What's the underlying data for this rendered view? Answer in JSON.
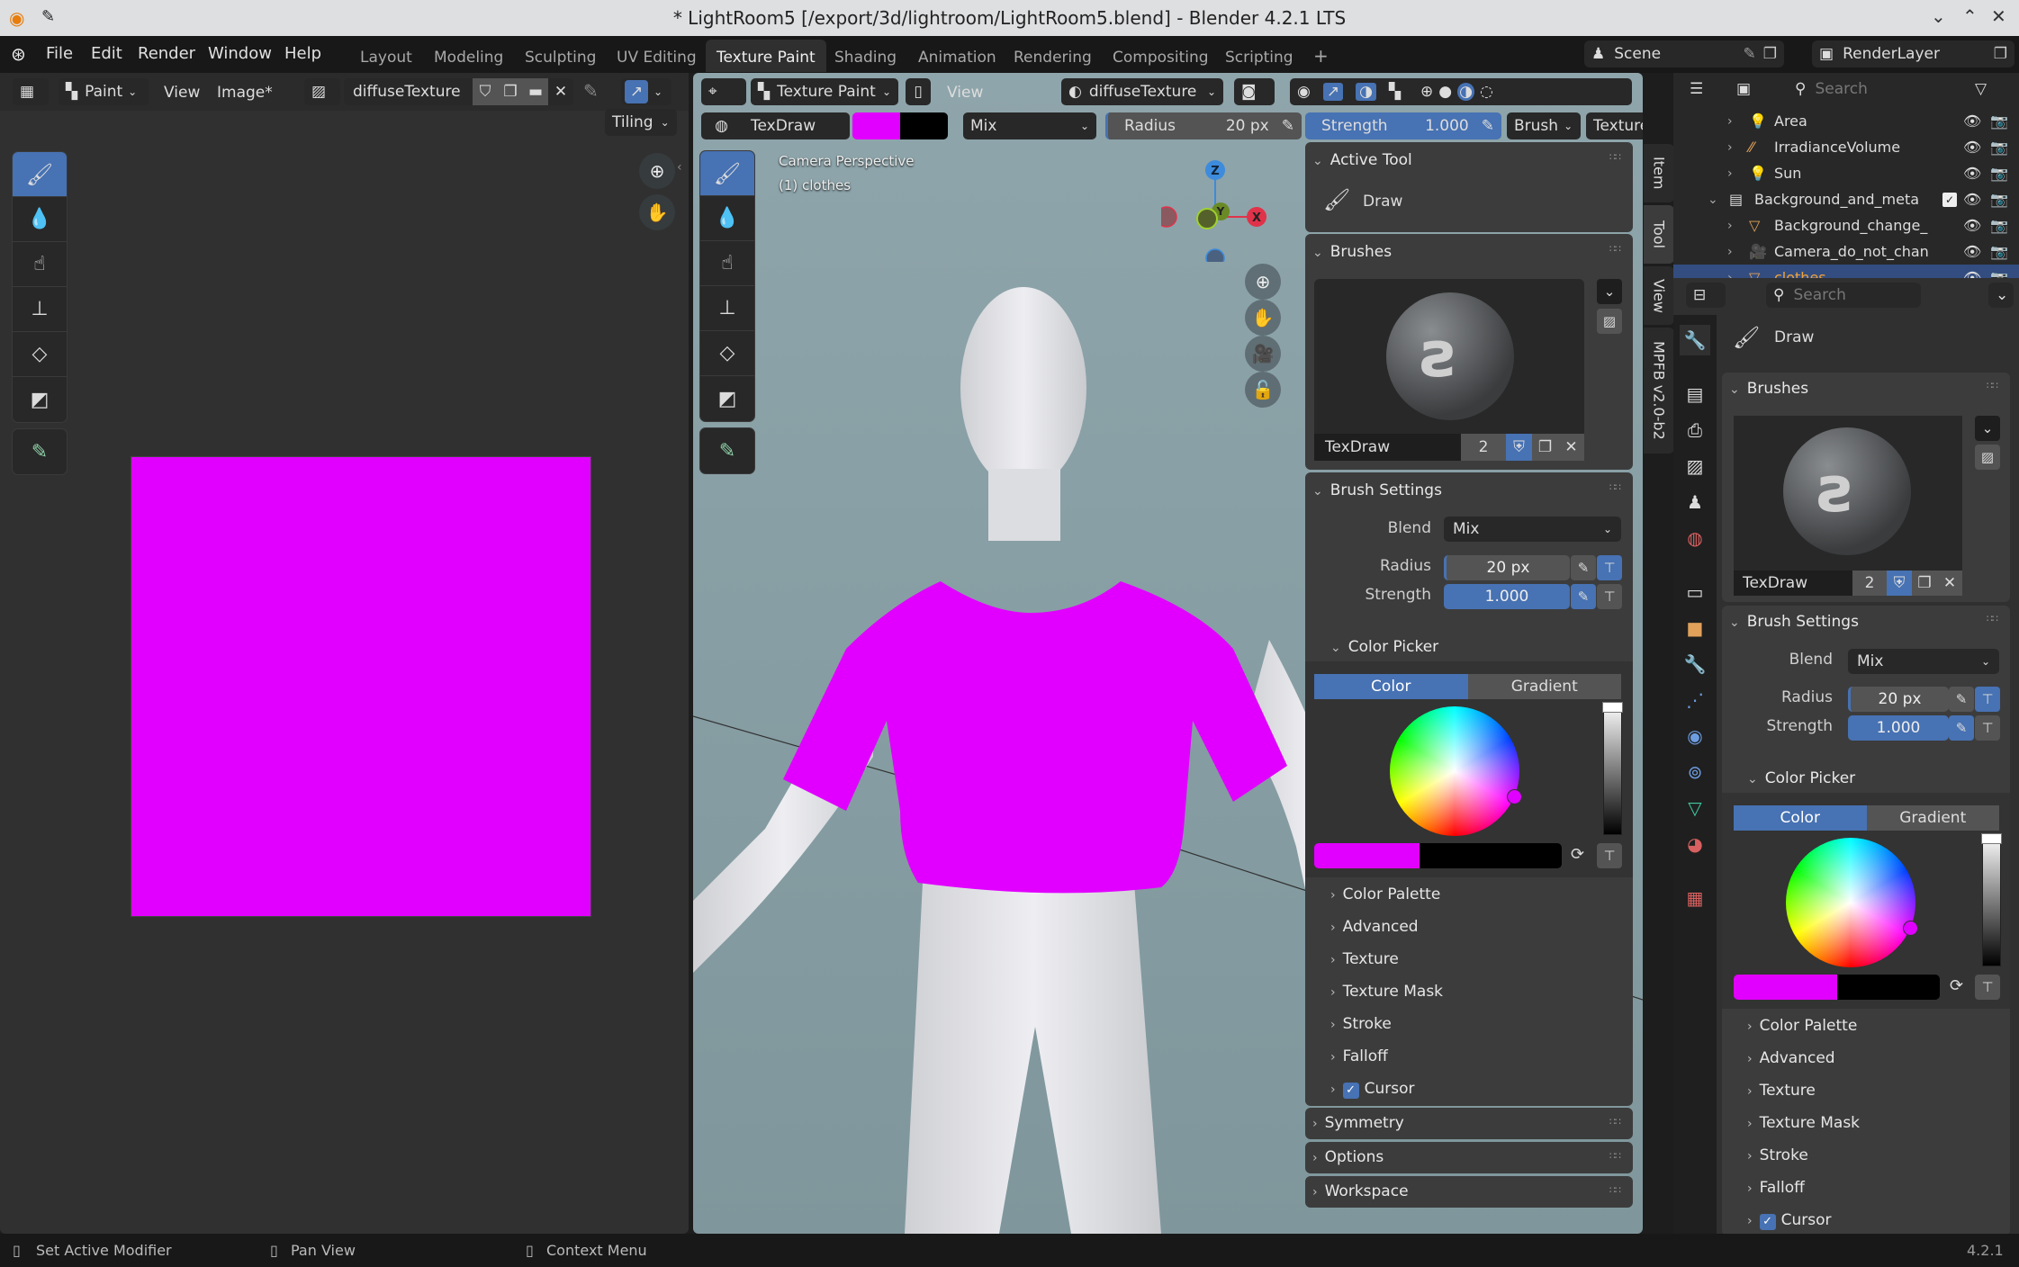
{
  "window": {
    "title": "* LightRoom5 [/export/3d/lightroom/LightRoom5.blend] - Blender 4.2.1 LTS",
    "controls": [
      "minimize-icon",
      "maximize-icon",
      "close-icon"
    ]
  },
  "menu": {
    "items": [
      "File",
      "Edit",
      "Render",
      "Window",
      "Help"
    ],
    "workspaces": [
      "Layout",
      "Modeling",
      "Sculpting",
      "UV Editing",
      "Texture Paint",
      "Shading",
      "Animation",
      "Rendering",
      "Compositing",
      "Scripting"
    ],
    "active_workspace": "Texture Paint",
    "add_workspace": "+",
    "scene": "Scene",
    "render_layer": "RenderLayer"
  },
  "image_editor": {
    "mode": "Paint",
    "view": "View",
    "image_menu": "Image*",
    "image_name": "diffuseTexture",
    "tiling": "Tiling",
    "canvas_color": "#e100ff",
    "tools": [
      "draw",
      "soften",
      "smear",
      "clone",
      "fill",
      "mask",
      "annotate"
    ]
  },
  "viewport": {
    "mode": "Texture Paint",
    "view": "View",
    "texture_slot": "diffuseTexture",
    "brush_name": "TexDraw",
    "primary_color": "#e100ff",
    "secondary_color": "#000000",
    "blend": "Mix",
    "radius_label": "Radius",
    "radius_value": "20 px",
    "strength_label": "Strength",
    "strength_value": "1.000",
    "brush_menu": "Brush",
    "texture_menu": "Texture",
    "overlay_line1": "Camera Perspective",
    "overlay_line2": "(1) clothes",
    "gizmo": {
      "z": "Z",
      "y": "Y",
      "x": "X"
    }
  },
  "npanel": {
    "tabs": [
      "Item",
      "Tool",
      "View",
      "MPFB v2.0-b2"
    ],
    "active_tool_title": "Active Tool",
    "active_tool": "Draw",
    "brushes_title": "Brushes",
    "brush_name": "TexDraw",
    "brush_users": "2",
    "brush_settings_title": "Brush Settings",
    "blend_label": "Blend",
    "blend_value": "Mix",
    "radius_label": "Radius",
    "radius_value": "20 px",
    "strength_label": "Strength",
    "strength_value": "1.000",
    "color_picker_title": "Color Picker",
    "color_tab": "Color",
    "gradient_tab": "Gradient",
    "subpanels": [
      "Color Palette",
      "Advanced",
      "Texture",
      "Texture Mask",
      "Stroke",
      "Falloff",
      "Cursor"
    ],
    "cursor_checked": true,
    "collapsed_panels": [
      "Symmetry",
      "Options",
      "Workspace"
    ]
  },
  "outliner": {
    "search_placeholder": "Search",
    "rows": [
      {
        "name": "Area",
        "type": "light",
        "indent": 1
      },
      {
        "name": "IrradianceVolume",
        "type": "lightprobe",
        "indent": 1
      },
      {
        "name": "Sun",
        "type": "light",
        "indent": 1
      },
      {
        "name": "Background_and_meta",
        "type": "collection",
        "indent": 0,
        "expanded": true
      },
      {
        "name": "Background_change_",
        "type": "mesh",
        "indent": 1
      },
      {
        "name": "Camera_do_not_chan",
        "type": "camera",
        "indent": 1
      },
      {
        "name": "clothes",
        "type": "mesh",
        "indent": 1,
        "selected": true
      }
    ]
  },
  "properties": {
    "search_placeholder": "Search",
    "active_tool": "Draw",
    "brushes_title": "Brushes",
    "brush_name": "TexDraw",
    "brush_users": "2",
    "brush_settings_title": "Brush Settings",
    "blend_label": "Blend",
    "blend_value": "Mix",
    "radius_label": "Radius",
    "radius_value": "20 px",
    "strength_label": "Strength",
    "strength_value": "1.000",
    "color_picker_title": "Color Picker",
    "color_tab": "Color",
    "gradient_tab": "Gradient",
    "subpanels": [
      "Color Palette",
      "Advanced",
      "Texture",
      "Texture Mask",
      "Stroke",
      "Falloff",
      "Cursor"
    ],
    "tabs": [
      "tool",
      "render",
      "output",
      "view-layer",
      "scene",
      "world",
      "collection",
      "object",
      "modifiers",
      "particles",
      "physics",
      "constraints",
      "data",
      "material",
      "texture"
    ]
  },
  "status": {
    "left": "Set Active Modifier",
    "middle": "Pan View",
    "right": "Context Menu",
    "version": "4.2.1"
  }
}
